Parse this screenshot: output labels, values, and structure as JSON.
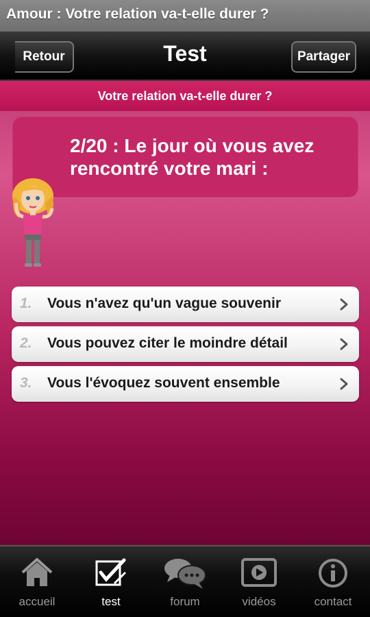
{
  "window": {
    "title": "Amour : Votre relation va-t-elle durer ?"
  },
  "nav": {
    "back_label": "Retour",
    "title": "Test",
    "share_label": "Partager"
  },
  "quiz": {
    "subtitle": "Votre relation va-t-elle durer ?",
    "question": "2/20 : Le jour où vous avez rencontré votre mari :",
    "answers": [
      {
        "number": "1.",
        "text": "Vous n'avez qu'un vague souvenir"
      },
      {
        "number": "2.",
        "text": "Vous pouvez citer le moindre détail"
      },
      {
        "number": "3.",
        "text": "Vous l'évoquez souvent ensemble"
      }
    ]
  },
  "tabs": [
    {
      "label": "accueil",
      "icon": "house-icon"
    },
    {
      "label": "test",
      "icon": "checkbox-pencil-icon",
      "active": true
    },
    {
      "label": "forum",
      "icon": "speech-bubbles-icon"
    },
    {
      "label": "vidéos",
      "icon": "play-icon"
    },
    {
      "label": "contact",
      "icon": "info-icon"
    }
  ],
  "colors": {
    "accent": "#c42765",
    "header": "#cf2466"
  }
}
